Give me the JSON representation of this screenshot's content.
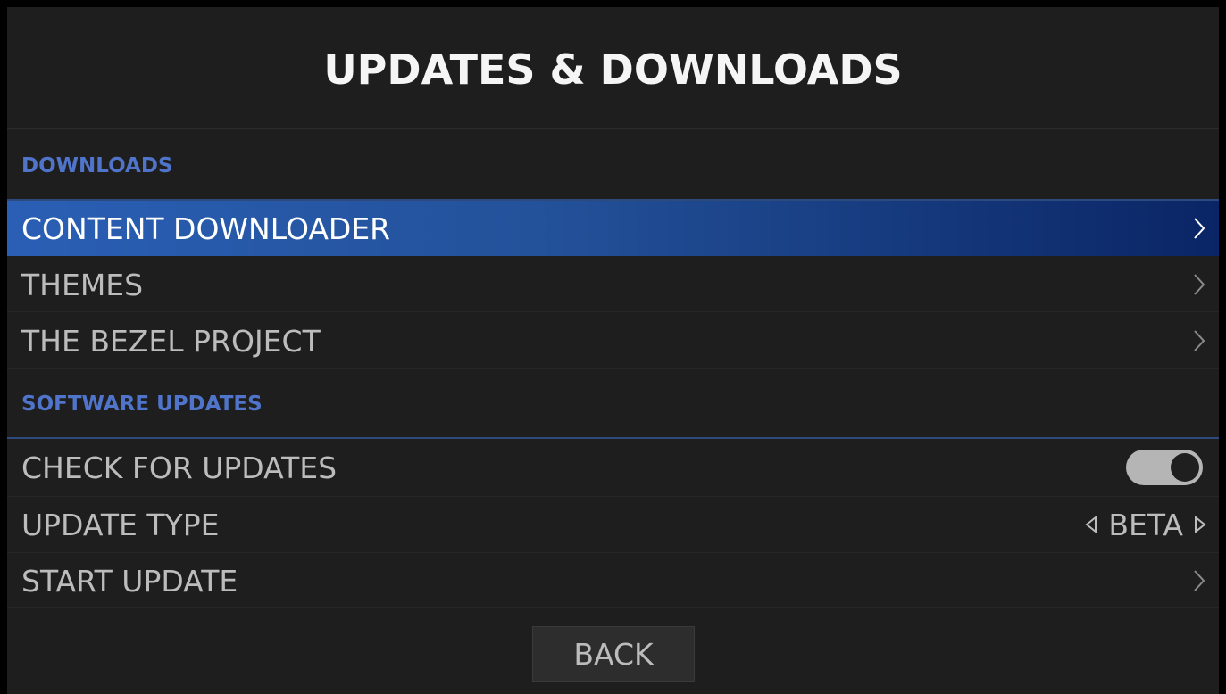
{
  "title": "UPDATES & DOWNLOADS",
  "sections": {
    "downloads": {
      "label": "DOWNLOADS",
      "items": [
        {
          "label": "CONTENT DOWNLOADER",
          "icon": "chevron-right-icon",
          "selected": true
        },
        {
          "label": "THEMES",
          "icon": "chevron-right-icon"
        },
        {
          "label": "THE BEZEL PROJECT",
          "icon": "chevron-right-icon"
        }
      ]
    },
    "software_updates": {
      "label": "SOFTWARE UPDATES",
      "check_for_updates": {
        "label": "CHECK FOR UPDATES",
        "value": true
      },
      "update_type": {
        "label": "UPDATE TYPE",
        "value": "BETA"
      },
      "start_update": {
        "label": "START UPDATE",
        "icon": "chevron-right-icon"
      }
    }
  },
  "back_label": "BACK",
  "colors": {
    "background": "#1e1e1e",
    "section_header": "#4f74c9",
    "selection_start": "#2a5fb5",
    "selection_end": "#0a2565",
    "text": "#bcbcbc"
  }
}
